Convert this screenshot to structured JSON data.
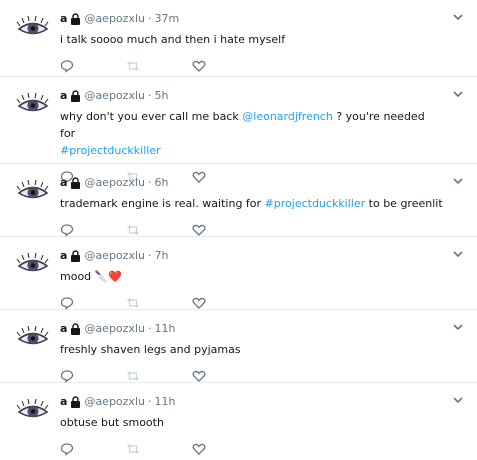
{
  "user": {
    "name": "a",
    "handle": "@aepozxlu"
  },
  "colors": {
    "link": "#1da1f2",
    "meta": "#657786",
    "divider": "#e6ecf0"
  },
  "icons": {
    "lock": "lock-icon",
    "caret": "chevron-down-icon",
    "reply": "reply-icon",
    "retweet": "retweet-icon",
    "like": "heart-icon"
  },
  "tweets": [
    {
      "time": "37m",
      "text": "i talk soooo much and then i hate myself"
    },
    {
      "time": "5h",
      "text_before": "why don't you ever call me back ",
      "mention": "@leonardjfrench",
      "text_mid": " ?  you're needed for ",
      "hashtag": "#projectduckkiller"
    },
    {
      "time": "6h",
      "text_before": "trademark engine is real.  waiting for ",
      "hashtag": "#projectduckkiller",
      "text_after": " to be greenlit"
    },
    {
      "time": "7h",
      "text": "mood",
      "emoji": "🔪❤️"
    },
    {
      "time": "11h",
      "text": "freshly shaven legs and pyjamas"
    },
    {
      "time": "11h",
      "text": "obtuse but smooth"
    }
  ]
}
